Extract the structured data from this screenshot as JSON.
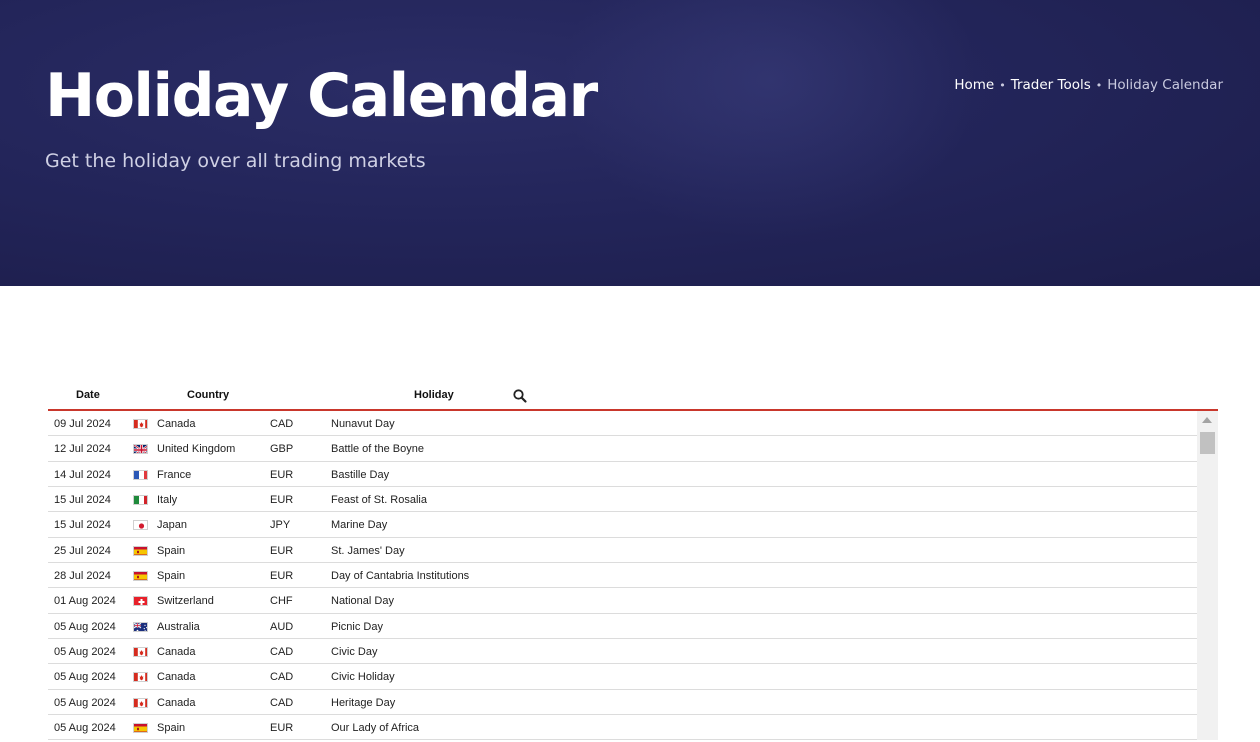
{
  "hero": {
    "title": "Holiday Calendar",
    "subtitle": "Get the holiday over all trading markets"
  },
  "breadcrumb": {
    "home": "Home",
    "tools": "Trader Tools",
    "current": "Holiday Calendar",
    "separator": "•"
  },
  "table": {
    "headers": {
      "date": "Date",
      "country": "Country",
      "holiday": "Holiday"
    },
    "search_icon": "search-icon",
    "accent_color": "#c9372c",
    "rows": [
      {
        "date": "09 Jul 2024",
        "flag": "canada",
        "country": "Canada",
        "currency": "CAD",
        "holiday": "Nunavut Day"
      },
      {
        "date": "12 Jul 2024",
        "flag": "uk",
        "country": "United Kingdom",
        "currency": "GBP",
        "holiday": "Battle of the Boyne"
      },
      {
        "date": "14 Jul 2024",
        "flag": "france",
        "country": "France",
        "currency": "EUR",
        "holiday": "Bastille Day"
      },
      {
        "date": "15 Jul 2024",
        "flag": "italy",
        "country": "Italy",
        "currency": "EUR",
        "holiday": "Feast of St. Rosalia"
      },
      {
        "date": "15 Jul 2024",
        "flag": "japan",
        "country": "Japan",
        "currency": "JPY",
        "holiday": "Marine Day"
      },
      {
        "date": "25 Jul 2024",
        "flag": "spain",
        "country": "Spain",
        "currency": "EUR",
        "holiday": "St. James' Day"
      },
      {
        "date": "28 Jul 2024",
        "flag": "spain",
        "country": "Spain",
        "currency": "EUR",
        "holiday": "Day of Cantabria Institutions"
      },
      {
        "date": "01 Aug 2024",
        "flag": "switzerland",
        "country": "Switzerland",
        "currency": "CHF",
        "holiday": "National Day"
      },
      {
        "date": "05 Aug 2024",
        "flag": "australia",
        "country": "Australia",
        "currency": "AUD",
        "holiday": "Picnic Day"
      },
      {
        "date": "05 Aug 2024",
        "flag": "canada",
        "country": "Canada",
        "currency": "CAD",
        "holiday": "Civic Day"
      },
      {
        "date": "05 Aug 2024",
        "flag": "canada",
        "country": "Canada",
        "currency": "CAD",
        "holiday": "Civic Holiday"
      },
      {
        "date": "05 Aug 2024",
        "flag": "canada",
        "country": "Canada",
        "currency": "CAD",
        "holiday": "Heritage Day"
      },
      {
        "date": "05 Aug 2024",
        "flag": "spain",
        "country": "Spain",
        "currency": "EUR",
        "holiday": "Our Lady of Africa"
      }
    ]
  }
}
